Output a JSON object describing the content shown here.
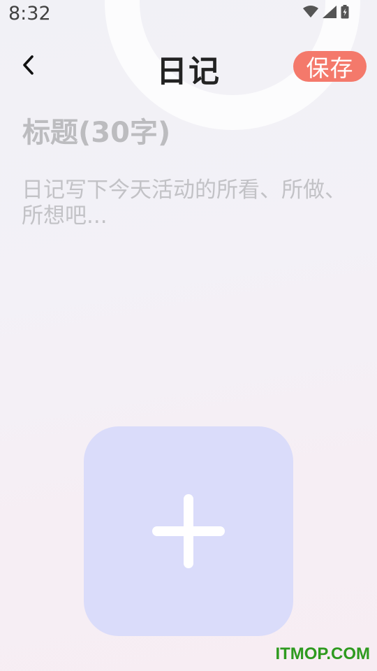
{
  "status_bar": {
    "time": "8:32",
    "icons": [
      "wifi-icon",
      "signal-icon",
      "battery-charging-icon"
    ]
  },
  "header": {
    "back_icon": "chevron-left-icon",
    "title": "日记",
    "save_label": "保存",
    "save_color": "#f4796b"
  },
  "editor": {
    "title_placeholder": "标题(30字)",
    "content_placeholder": "日记写下今天活动的所看、所做、所想吧..."
  },
  "add_image": {
    "icon": "plus-icon",
    "color": "#dadcfa"
  },
  "watermark": "ITMOP.COM"
}
